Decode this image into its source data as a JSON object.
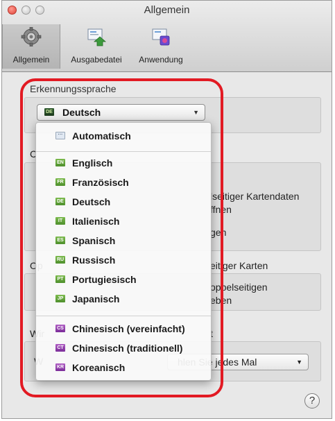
{
  "window": {
    "title": "Allgemein"
  },
  "toolbar": {
    "items": [
      {
        "label": "Allgemein",
        "icon": "gear-icon",
        "selected": true
      },
      {
        "label": "Ausgabedatei",
        "icon": "output-file-icon",
        "selected": false
      },
      {
        "label": "Anwendung",
        "icon": "application-icon",
        "selected": false
      }
    ]
  },
  "recognition": {
    "section_label": "Erkennungssprache",
    "selected_code": "DE",
    "selected_value": "Deutsch"
  },
  "background": {
    "line1": "C",
    "line2": "lseitiger Kartendaten",
    "line3": "ffnen",
    "line4": "gen",
    "line5": "Op",
    "line6": "eitiger Karten",
    "line7": "oppelseitigen",
    "line8": "eben",
    "line9": "Wir",
    "line10": "t",
    "line11": "W",
    "select_value": "hlen Sie jedes Mal"
  },
  "menu": {
    "auto": {
      "code": "···",
      "label": "Automatisch"
    },
    "languages": [
      {
        "code": "EN",
        "label": "Englisch"
      },
      {
        "code": "FR",
        "label": "Französisch"
      },
      {
        "code": "DE",
        "label": "Deutsch"
      },
      {
        "code": "IT",
        "label": "Italienisch"
      },
      {
        "code": "ES",
        "label": "Spanisch"
      },
      {
        "code": "RU",
        "label": "Russisch"
      },
      {
        "code": "PT",
        "label": "Portugiesisch"
      },
      {
        "code": "JP",
        "label": "Japanisch"
      }
    ],
    "asian": [
      {
        "code": "CS",
        "label": "Chinesisch (vereinfacht)"
      },
      {
        "code": "CT",
        "label": "Chinesisch (traditionell)"
      },
      {
        "code": "KR",
        "label": "Koreanisch"
      }
    ]
  },
  "help": {
    "label": "?"
  },
  "colors": {
    "highlight": "#e21a23",
    "flag_green": "#5a9a35",
    "flag_purple": "#8a3aa8"
  }
}
